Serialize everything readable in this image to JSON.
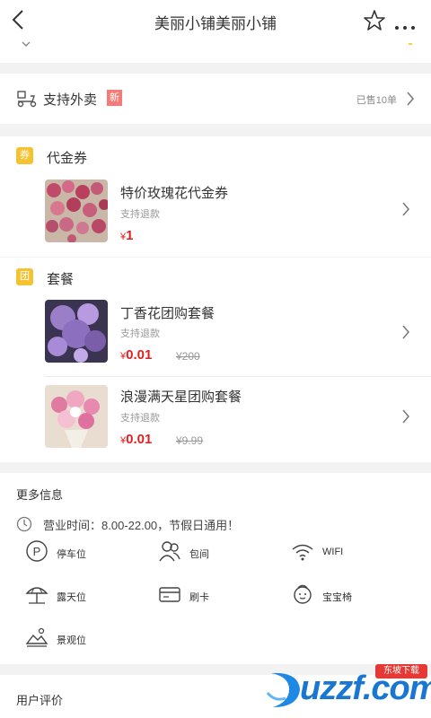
{
  "header": {
    "title": "美丽小铺美丽小铺"
  },
  "delivery": {
    "label": "支持外卖",
    "badge": "新",
    "sold": "已售10单"
  },
  "voucher_section": {
    "title": "代金券",
    "icon_char": "券",
    "items": [
      {
        "name": "特价玫瑰花代金券",
        "sub": "支持退款",
        "price_symbol": "¥",
        "price": "1"
      }
    ]
  },
  "package_section": {
    "title": "套餐",
    "icon_char": "团",
    "items": [
      {
        "name": "丁香花团购套餐",
        "sub": "支持退款",
        "price_symbol": "¥",
        "price": "0.01",
        "original": "¥200"
      },
      {
        "name": "浪漫满天星团购套餐",
        "sub": "支持退款",
        "price_symbol": "¥",
        "price": "0.01",
        "original": "¥9.99"
      }
    ]
  },
  "more_info": {
    "title": "更多信息",
    "hours": "营业时间：8.00-22.00，节假日通用！",
    "facilities": [
      {
        "label": "停车位",
        "icon": "parking-icon"
      },
      {
        "label": "包间",
        "icon": "private-room-icon"
      },
      {
        "label": "WIFI",
        "icon": "wifi-icon"
      },
      {
        "label": "露天位",
        "icon": "umbrella-icon"
      },
      {
        "label": "刷卡",
        "icon": "card-icon"
      },
      {
        "label": "宝宝椅",
        "icon": "baby-icon"
      },
      {
        "label": "景观位",
        "icon": "landscape-icon"
      }
    ]
  },
  "reviews": {
    "title": "用户评价"
  },
  "watermark": {
    "text": "uzzf.com",
    "tag": "东坡下载"
  },
  "colors": {
    "accent_red": "#e02020",
    "section_icon": "#f5c332",
    "badge": "#f0514c"
  }
}
